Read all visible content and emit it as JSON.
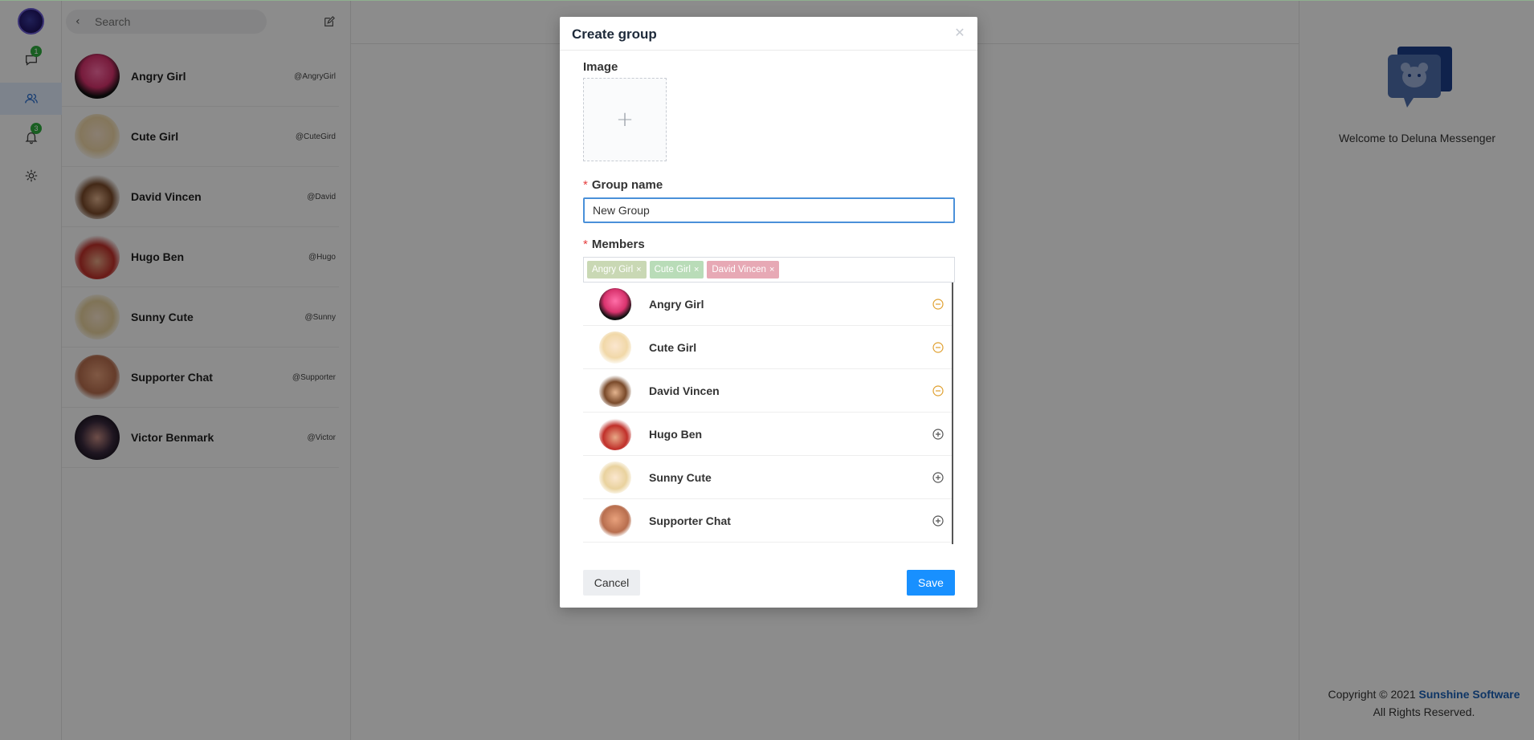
{
  "rail": {
    "chat_badge": "1",
    "notification_badge": "3",
    "icons": [
      "app-logo",
      "chat-icon",
      "contacts-icon",
      "bell-icon",
      "gear-icon"
    ]
  },
  "search": {
    "placeholder": "Search"
  },
  "contacts": [
    {
      "name": "Angry Girl",
      "handle": "@AngryGirl"
    },
    {
      "name": "Cute Girl",
      "handle": "@CuteGird"
    },
    {
      "name": "David Vincen",
      "handle": "@David"
    },
    {
      "name": "Hugo Ben",
      "handle": "@Hugo"
    },
    {
      "name": "Sunny Cute",
      "handle": "@Sunny"
    },
    {
      "name": "Supporter Chat",
      "handle": "@Supporter"
    },
    {
      "name": "Victor Benmark",
      "handle": "@Victor"
    }
  ],
  "right_panel": {
    "welcome": "Welcome to Deluna Messenger",
    "copyright_prefix": "Copyright © 2021",
    "copyright_brand": "Sunshine Software",
    "copyright_suffix": "All Rights Reserved."
  },
  "modal": {
    "title": "Create group",
    "image_label": "Image",
    "upload_symbol": "+",
    "group_name_label": "Group name",
    "group_name_value": "New Group",
    "members_label": "Members",
    "chips": [
      {
        "label": "Angry Girl",
        "color": "#c9d8b4"
      },
      {
        "label": "Cute Girl",
        "color": "#b9dcb8"
      },
      {
        "label": "David Vincen",
        "color": "#e7a9b5"
      }
    ],
    "members": [
      {
        "name": "Angry Girl",
        "selected": true
      },
      {
        "name": "Cute Girl",
        "selected": true
      },
      {
        "name": "David Vincen",
        "selected": true
      },
      {
        "name": "Hugo Ben",
        "selected": false
      },
      {
        "name": "Sunny Cute",
        "selected": false
      },
      {
        "name": "Supporter Chat",
        "selected": false
      }
    ],
    "cancel_label": "Cancel",
    "save_label": "Save"
  },
  "colors": {
    "accent": "#1890ff",
    "badge": "#2eae3f",
    "remove_member": "#e0a030",
    "brand": "#1b62b8"
  }
}
